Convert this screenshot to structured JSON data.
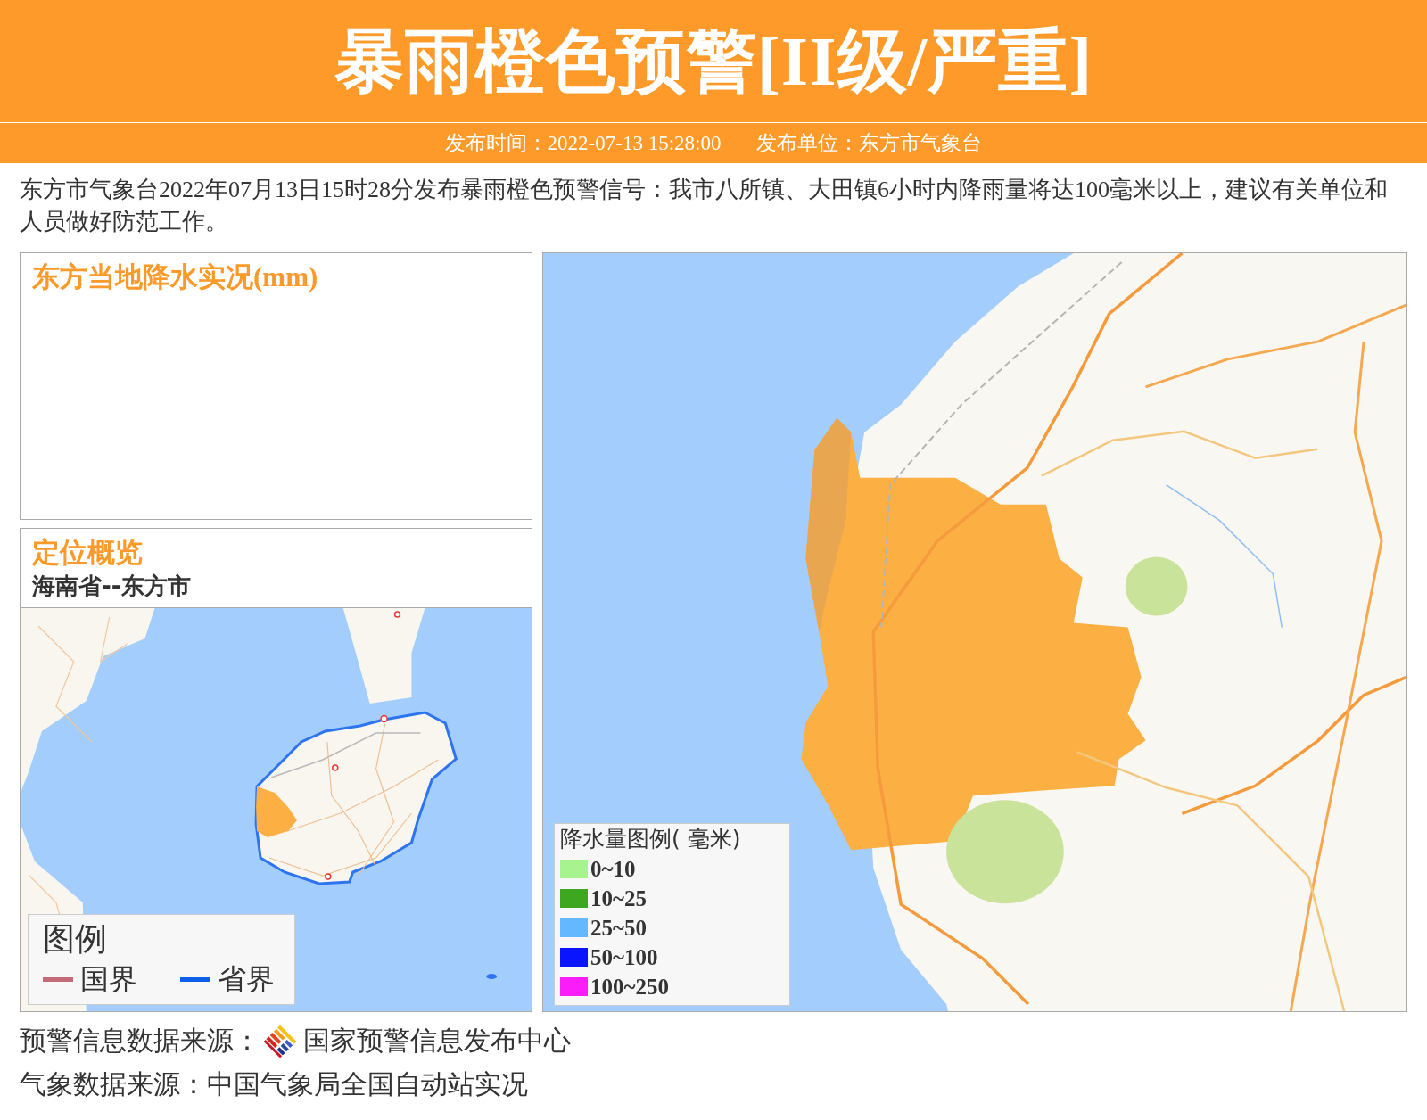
{
  "header": {
    "title": "暴雨橙色预警[II级/严重]",
    "publish_time": "发布时间：2022-07-13 15:28:00",
    "publisher": "发布单位：东方市气象台"
  },
  "description": "东方市气象台2022年07月13日15时28分发布暴雨橙色预警信号：我市八所镇、大田镇6小时内降雨量将达100毫米以上，建议有关单位和人员做好防范工作。",
  "rainfall_panel": {
    "title": "东方当地降水实况(mm)"
  },
  "location_panel": {
    "title": "定位概览",
    "subtitle": "海南省--东方市",
    "legend": {
      "title": "图例",
      "items": [
        {
          "label": "国界",
          "color": "#c46b7a"
        },
        {
          "label": "省界",
          "color": "#0b5fe8"
        }
      ]
    }
  },
  "detail_map": {
    "legend": {
      "title": "降水量图例( 毫米)",
      "items": [
        {
          "label": "0~10",
          "color": "#a7f38f"
        },
        {
          "label": "10~25",
          "color": "#3da81f"
        },
        {
          "label": "25~50",
          "color": "#63b8ff"
        },
        {
          "label": "50~100",
          "color": "#0a14ff"
        },
        {
          "label": "100~250",
          "color": "#fa1dfa"
        }
      ]
    }
  },
  "sources": [
    {
      "kind": "logo",
      "label": "预警信息数据来源：",
      "value": "国家预警信息发布中心"
    },
    {
      "kind": "plain",
      "label": "气象数据来源：",
      "value": "中国气象局全国自动站实况"
    }
  ]
}
